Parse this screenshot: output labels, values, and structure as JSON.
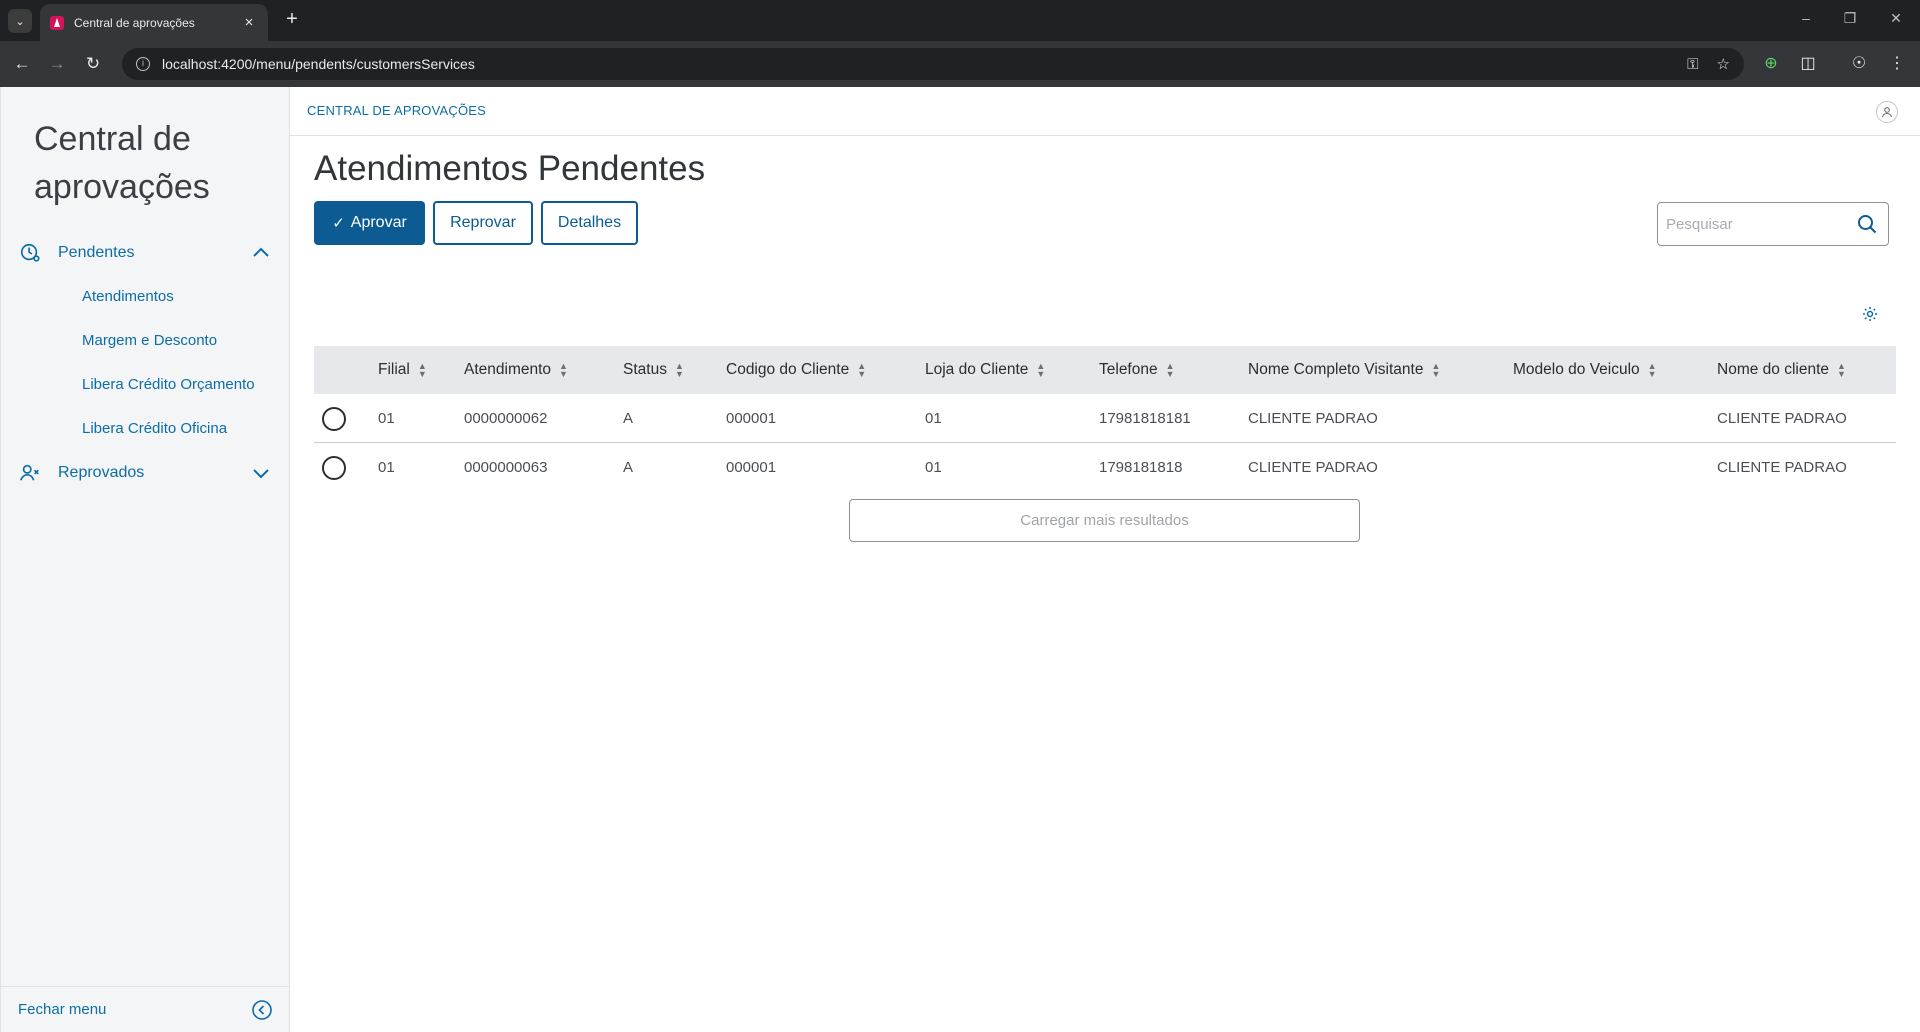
{
  "browser": {
    "tab_title": "Central de aprovações",
    "url": "localhost:4200/menu/pendents/customersServices"
  },
  "sidebar": {
    "brand": "Central de aprovações",
    "groups": [
      {
        "label": "Pendentes",
        "expanded": true,
        "items": [
          "Atendimentos",
          "Margem e Desconto",
          "Libera Crédito Orçamento",
          "Libera Crédito Oficina"
        ]
      },
      {
        "label": "Reprovados",
        "expanded": false,
        "items": []
      }
    ],
    "footer_label": "Fechar menu"
  },
  "header": {
    "breadcrumb": "CENTRAL DE APROVAÇÕES"
  },
  "page": {
    "title": "Atendimentos Pendentes",
    "actions": {
      "approve": "Aprovar",
      "reject": "Reprovar",
      "details": "Detalhes"
    },
    "search_placeholder": "Pesquisar",
    "load_more": "Carregar mais resultados"
  },
  "table": {
    "columns": [
      "Filial",
      "Atendimento",
      "Status",
      "Codigo do Cliente",
      "Loja do Cliente",
      "Telefone",
      "Nome Completo Visitante",
      "Modelo do Veiculo",
      "Nome do cliente"
    ],
    "rows": [
      [
        "01",
        "0000000062",
        "A",
        "000001",
        "01",
        "17981818181",
        "CLIENTE PADRAO",
        "",
        "CLIENTE PADRAO"
      ],
      [
        "01",
        "0000000063",
        "A",
        "000001",
        "01",
        "1798181818",
        "CLIENTE PADRAO",
        "",
        "CLIENTE PADRAO"
      ]
    ]
  },
  "colors": {
    "primary": "#0c5c93",
    "link": "#0c6da6",
    "header_bg": "#e6e8eb",
    "sidebar_bg": "#f4f5f7"
  }
}
